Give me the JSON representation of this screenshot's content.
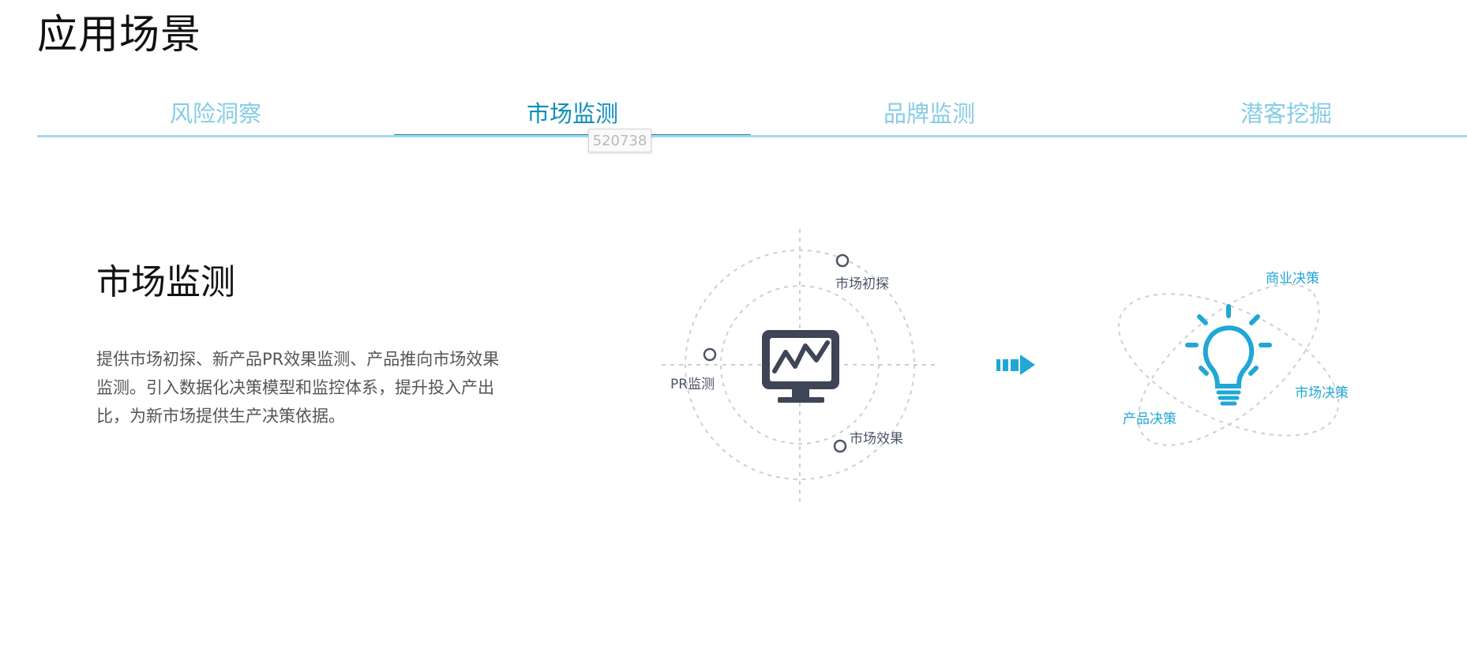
{
  "page": {
    "title": "应用场景"
  },
  "tabs": [
    {
      "label": "风险洞察",
      "active": false
    },
    {
      "label": "市场监测",
      "active": true
    },
    {
      "label": "品牌监测",
      "active": false
    },
    {
      "label": "潜客挖掘",
      "active": false
    }
  ],
  "tooltip": {
    "text": "520738"
  },
  "section": {
    "title": "市场监测",
    "description": "提供市场初探、新产品PR效果监测、产品推向市场效果监测。引入数据化决策模型和监控体系，提升投入产出比，为新市场提供生产决策依据。"
  },
  "diagram": {
    "left_labels": {
      "top": "市场初探",
      "left": "PR监测",
      "bottom": "市场效果"
    },
    "right_labels": {
      "top": "商业决策",
      "right": "市场决策",
      "left": "产品决策"
    },
    "icons": {
      "center_left": "monitor-chart-icon",
      "arrow": "arrow-right-icon",
      "center_right": "lightbulb-icon"
    }
  },
  "colors": {
    "accent": "#0e8fb8",
    "tab_inactive": "#86cce6",
    "tab_line": "#a8d8eb",
    "diagram_dark": "#4b5468",
    "diagram_blue": "#21a7d5"
  }
}
